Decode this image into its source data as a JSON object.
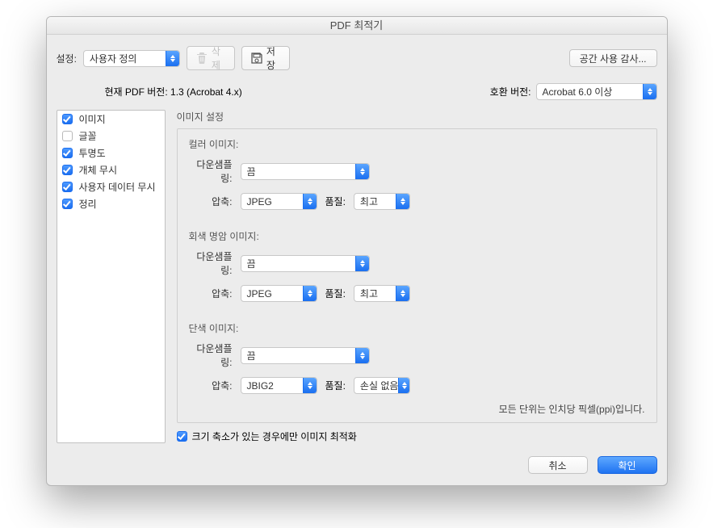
{
  "window": {
    "title": "PDF 최적기"
  },
  "top": {
    "settingsLabel": "설정:",
    "preset": "사용자 정의",
    "deleteLabel": "삭제",
    "saveLabel": "저장",
    "auditLabel": "공간 사용 감사..."
  },
  "version": {
    "currentLabel": "현재 PDF 버전:",
    "currentValue": "1.3 (Acrobat 4.x)",
    "compatLabel": "호환 버전:",
    "compatValue": "Acrobat 6.0 이상"
  },
  "sidebar": {
    "items": [
      {
        "label": "이미지",
        "checked": true
      },
      {
        "label": "글꼴",
        "checked": false
      },
      {
        "label": "투명도",
        "checked": true
      },
      {
        "label": "개체 무시",
        "checked": true
      },
      {
        "label": "사용자 데이터 무시",
        "checked": true
      },
      {
        "label": "정리",
        "checked": true
      }
    ]
  },
  "panel": {
    "title": "이미지 설정",
    "labels": {
      "color": "컬러 이미지:",
      "gray": "회색 명암 이미지:",
      "mono": "단색 이미지:",
      "downsample": "다운샘플링:",
      "compress": "압축:",
      "quality": "품질:"
    },
    "color": {
      "downsample": "끔",
      "compress": "JPEG",
      "quality": "최고"
    },
    "gray": {
      "downsample": "끔",
      "compress": "JPEG",
      "quality": "최고"
    },
    "mono": {
      "downsample": "끔",
      "compress": "JBIG2",
      "quality": "손실 없음"
    },
    "footer": "모든 단위는 인치당 픽셀(ppi)입니다.",
    "optimizeOnlyIfSmallerLabel": "크기 축소가 있는 경우에만 이미지 최적화"
  },
  "buttons": {
    "cancel": "취소",
    "ok": "확인"
  }
}
